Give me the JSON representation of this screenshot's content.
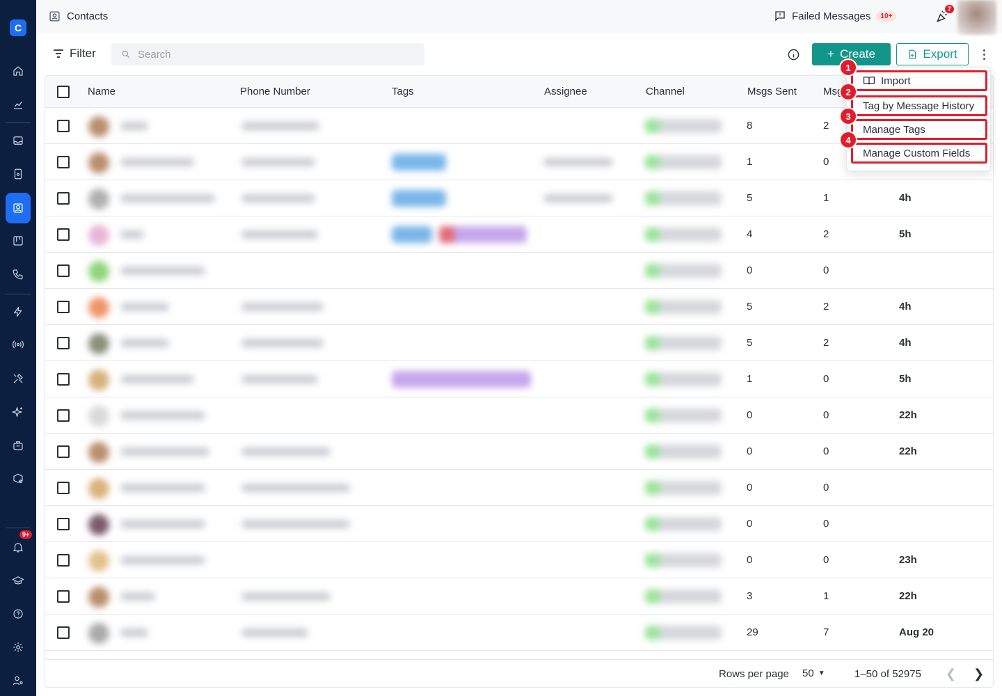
{
  "app": {
    "logo_letter": "C"
  },
  "sidebar": {
    "items": [
      {
        "name": "home-icon"
      },
      {
        "name": "analytics-icon"
      },
      {
        "name": "inbox-icon"
      },
      {
        "name": "device-icon"
      },
      {
        "name": "contacts-icon",
        "active": true
      },
      {
        "name": "board-icon"
      },
      {
        "name": "phone-icon"
      },
      {
        "name": "lightning-icon"
      },
      {
        "name": "broadcast-icon"
      },
      {
        "name": "tools-icon"
      },
      {
        "name": "sparkle-icon"
      },
      {
        "name": "briefcase-icon"
      },
      {
        "name": "package-settings-icon"
      },
      {
        "name": "bell-icon",
        "badge": "9+"
      },
      {
        "name": "graduation-icon"
      },
      {
        "name": "help-icon"
      },
      {
        "name": "settings-icon"
      },
      {
        "name": "user-settings-icon"
      }
    ]
  },
  "topbar": {
    "title": "Contacts",
    "failed_label": "Failed Messages",
    "failed_badge": "10+",
    "notification_badge": "7"
  },
  "toolbar": {
    "filter_label": "Filter",
    "search_placeholder": "Search",
    "create_label": "Create",
    "export_label": "Export"
  },
  "table": {
    "columns": [
      "Name",
      "Phone Number",
      "Tags",
      "Assignee",
      "Channel",
      "Msgs Sent",
      "Msgs"
    ],
    "rows": [
      {
        "sent": "8",
        "recv": "2",
        "last": ""
      },
      {
        "sent": "1",
        "recv": "0",
        "last": ""
      },
      {
        "sent": "5",
        "recv": "1",
        "last": "4h"
      },
      {
        "sent": "4",
        "recv": "2",
        "last": "5h"
      },
      {
        "sent": "0",
        "recv": "0",
        "last": ""
      },
      {
        "sent": "5",
        "recv": "2",
        "last": "4h"
      },
      {
        "sent": "5",
        "recv": "2",
        "last": "4h"
      },
      {
        "sent": "1",
        "recv": "0",
        "last": "5h"
      },
      {
        "sent": "0",
        "recv": "0",
        "last": "22h"
      },
      {
        "sent": "0",
        "recv": "0",
        "last": "22h"
      },
      {
        "sent": "0",
        "recv": "0",
        "last": ""
      },
      {
        "sent": "0",
        "recv": "0",
        "last": ""
      },
      {
        "sent": "0",
        "recv": "0",
        "last": "23h"
      },
      {
        "sent": "3",
        "recv": "1",
        "last": "22h"
      },
      {
        "sent": "29",
        "recv": "7",
        "last": "Aug 20"
      }
    ]
  },
  "pagination": {
    "rows_per_page_label": "Rows per page",
    "rows_per_page_value": "50",
    "range": "1–50 of 52975"
  },
  "dropdown": {
    "items": [
      {
        "num": "1",
        "label": "Import"
      },
      {
        "num": "2",
        "label": "Tag by Message History"
      },
      {
        "num": "3",
        "label": "Manage Tags"
      },
      {
        "num": "4",
        "label": "Manage Custom Fields"
      }
    ]
  },
  "colors": {
    "sidebar_bg": "#0c1f3f",
    "accent": "#13968a",
    "active_nav": "#1f6df2",
    "highlight": "#e11d2b"
  }
}
